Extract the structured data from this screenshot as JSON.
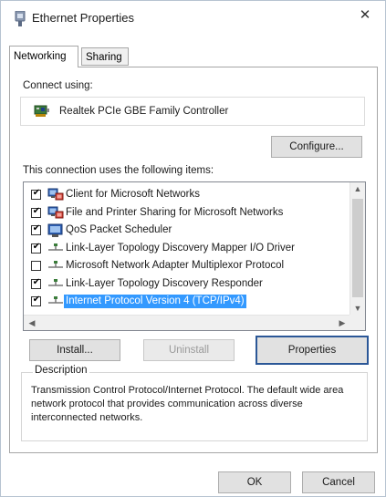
{
  "window": {
    "title": "Ethernet Properties",
    "close_glyph": "✕"
  },
  "tabs": [
    {
      "label": "Networking",
      "active": true
    },
    {
      "label": "Sharing",
      "active": false
    }
  ],
  "connect_using": {
    "label": "Connect using:",
    "adapter_name": "Realtek PCIe GBE Family Controller",
    "adapter_icon": "network-adapter-icon"
  },
  "buttons": {
    "configure": "Configure...",
    "install": "Install...",
    "uninstall": "Uninstall",
    "properties": "Properties",
    "ok": "OK",
    "cancel": "Cancel"
  },
  "items_label": "This connection uses the following items:",
  "items": [
    {
      "label": "Client for Microsoft Networks",
      "checked": true,
      "icon": "client-network-icon",
      "selected": false
    },
    {
      "label": "File and Printer Sharing for Microsoft Networks",
      "checked": true,
      "icon": "client-network-icon",
      "selected": false
    },
    {
      "label": "QoS Packet Scheduler",
      "checked": true,
      "icon": "qos-scheduler-icon",
      "selected": false
    },
    {
      "label": "Link-Layer Topology Discovery Mapper I/O Driver",
      "checked": true,
      "icon": "protocol-icon",
      "selected": false
    },
    {
      "label": "Microsoft Network Adapter Multiplexor Protocol",
      "checked": false,
      "icon": "protocol-icon",
      "selected": false
    },
    {
      "label": "Link-Layer Topology Discovery Responder",
      "checked": true,
      "icon": "protocol-icon",
      "selected": false
    },
    {
      "label": "Internet Protocol Version 4 (TCP/IPv4)",
      "checked": true,
      "icon": "protocol-icon",
      "selected": true
    }
  ],
  "description": {
    "legend": "Description",
    "text": "Transmission Control Protocol/Internet Protocol. The default wide area network protocol that provides communication across diverse interconnected networks."
  },
  "colors": {
    "selection": "#3399ff",
    "focus_border": "#2b5797"
  }
}
